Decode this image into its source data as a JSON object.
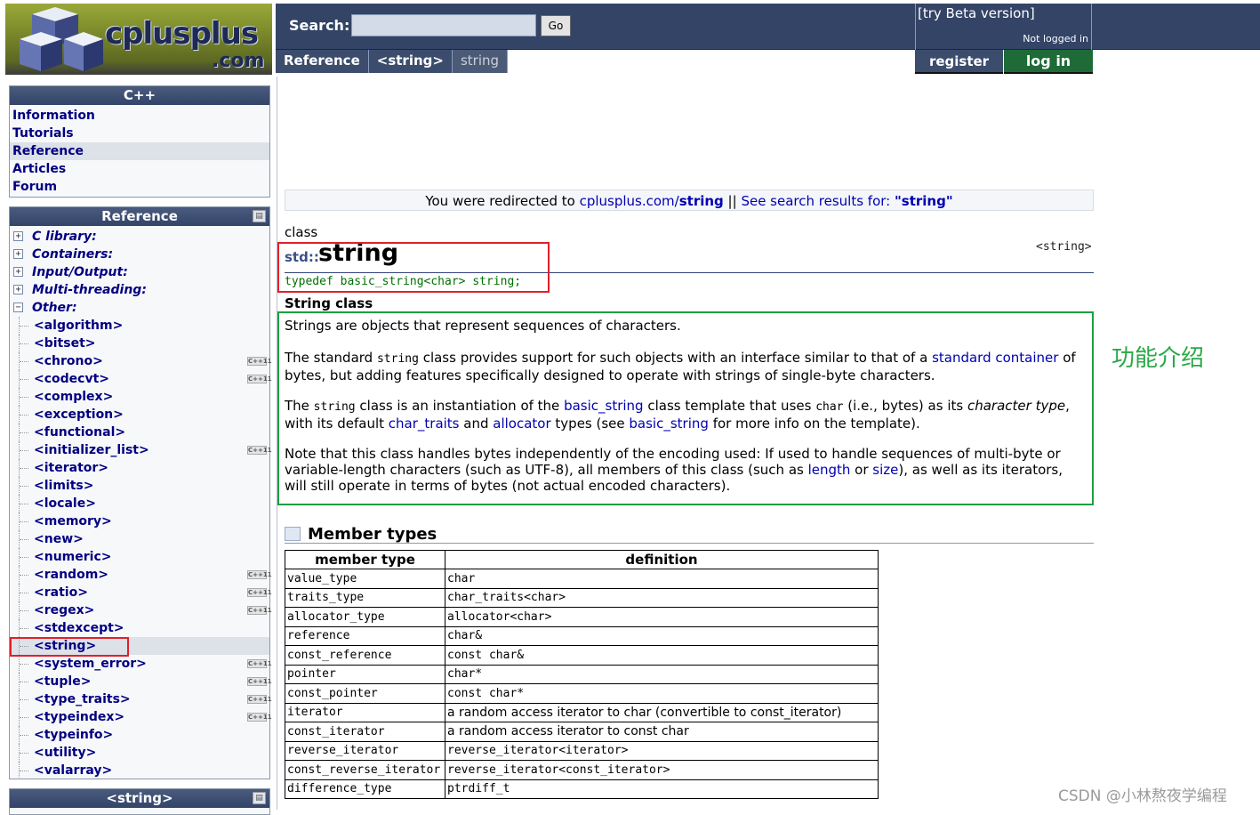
{
  "logo": {
    "word": "cplusplus",
    "com": ".com"
  },
  "search": {
    "label": "Search:",
    "value": "",
    "go": "Go"
  },
  "beta": {
    "link": "[try Beta version]",
    "status": "Not logged in"
  },
  "breadcrumb": [
    "Reference",
    "<string>",
    "string"
  ],
  "account": {
    "register": "register",
    "login": "log in"
  },
  "cpp_panel": {
    "title": "C++",
    "items": [
      "Information",
      "Tutorials",
      "Reference",
      "Articles",
      "Forum"
    ],
    "selected": "Reference"
  },
  "ref_panel": {
    "title": "Reference",
    "categories": [
      "C library:",
      "Containers:",
      "Input/Output:",
      "Multi-threading:",
      "Other:"
    ],
    "headers": [
      {
        "name": "<algorithm>",
        "cpp11": false
      },
      {
        "name": "<bitset>",
        "cpp11": false
      },
      {
        "name": "<chrono>",
        "cpp11": true
      },
      {
        "name": "<codecvt>",
        "cpp11": true
      },
      {
        "name": "<complex>",
        "cpp11": false
      },
      {
        "name": "<exception>",
        "cpp11": false
      },
      {
        "name": "<functional>",
        "cpp11": false
      },
      {
        "name": "<initializer_list>",
        "cpp11": true
      },
      {
        "name": "<iterator>",
        "cpp11": false
      },
      {
        "name": "<limits>",
        "cpp11": false
      },
      {
        "name": "<locale>",
        "cpp11": false
      },
      {
        "name": "<memory>",
        "cpp11": false
      },
      {
        "name": "<new>",
        "cpp11": false
      },
      {
        "name": "<numeric>",
        "cpp11": false
      },
      {
        "name": "<random>",
        "cpp11": true
      },
      {
        "name": "<ratio>",
        "cpp11": true
      },
      {
        "name": "<regex>",
        "cpp11": true
      },
      {
        "name": "<stdexcept>",
        "cpp11": false
      },
      {
        "name": "<string>",
        "cpp11": false
      },
      {
        "name": "<system_error>",
        "cpp11": true
      },
      {
        "name": "<tuple>",
        "cpp11": true
      },
      {
        "name": "<type_traits>",
        "cpp11": true
      },
      {
        "name": "<typeindex>",
        "cpp11": true
      },
      {
        "name": "<typeinfo>",
        "cpp11": false
      },
      {
        "name": "<utility>",
        "cpp11": false
      },
      {
        "name": "<valarray>",
        "cpp11": false
      }
    ],
    "selected": "<string>",
    "cpp11_badge": "C++11"
  },
  "string_panel": {
    "title": "<string>"
  },
  "redirect": {
    "prefix": "You were redirected to ",
    "site": "cplusplus.com/",
    "target": "string",
    "sep": " || ",
    "search": "See search results for: ",
    "query": "\"string\""
  },
  "entry": {
    "kind": "class",
    "ns": "std::",
    "name": "string",
    "header": "<string>",
    "typedef": "typedef basic_string<char> string;",
    "section": "String class"
  },
  "annotation": "功能介绍",
  "member_types": {
    "title": "Member types",
    "columns": [
      "member type",
      "definition"
    ],
    "rows": [
      [
        "value_type",
        "char"
      ],
      [
        "traits_type",
        "char_traits<char>"
      ],
      [
        "allocator_type",
        "allocator<char>"
      ],
      [
        "reference",
        "char&"
      ],
      [
        "const_reference",
        "const char&"
      ],
      [
        "pointer",
        "char*"
      ],
      [
        "const_pointer",
        "const char*"
      ],
      [
        "iterator",
        "a random access iterator to char (convertible to const_iterator)"
      ],
      [
        "const_iterator",
        "a random access iterator to const char"
      ],
      [
        "reverse_iterator",
        "reverse_iterator<iterator>"
      ],
      [
        "const_reverse_iterator",
        "reverse_iterator<const_iterator>"
      ],
      [
        "difference_type",
        "ptrdiff_t"
      ]
    ]
  },
  "watermark": "CSDN @小林熬夜学编程",
  "colors": {
    "nav": "#334466",
    "link": "#0000b0",
    "login": "#1f6b38",
    "highlight_red": "#e0202a",
    "highlight_green": "#1aa040"
  }
}
